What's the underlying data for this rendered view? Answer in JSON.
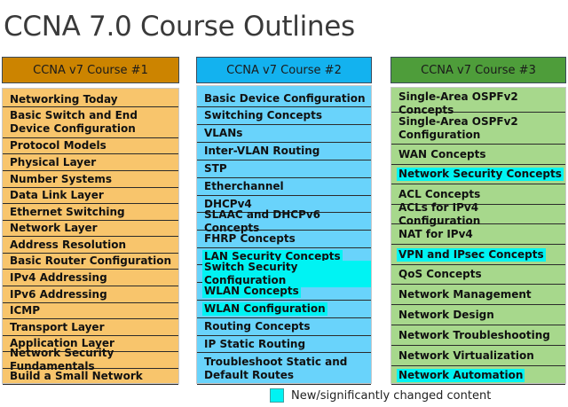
{
  "title": "CCNA 7.0 Course Outlines",
  "colors": {
    "course1_header": "#cc8400",
    "course1_body": "#f8c56c",
    "course2_header": "#13b2ef",
    "course2_body": "#69d3fb",
    "course3_header": "#4e9d3a",
    "course3_body": "#a7d88c",
    "highlight": "#00f3f3"
  },
  "courses": [
    {
      "header": "CCNA v7 Course #1",
      "items": [
        {
          "label": "Networking Today",
          "changed": false
        },
        {
          "label": "Basic Switch and End Device Configuration",
          "changed": false
        },
        {
          "label": "Protocol Models",
          "changed": false
        },
        {
          "label": "Physical Layer",
          "changed": false
        },
        {
          "label": "Number Systems",
          "changed": false
        },
        {
          "label": "Data Link Layer",
          "changed": false
        },
        {
          "label": "Ethernet Switching",
          "changed": false
        },
        {
          "label": "Network Layer",
          "changed": false
        },
        {
          "label": "Address Resolution",
          "changed": false
        },
        {
          "label": "Basic Router Configuration",
          "changed": false
        },
        {
          "label": "IPv4 Addressing",
          "changed": false
        },
        {
          "label": "IPv6 Addressing",
          "changed": false
        },
        {
          "label": "ICMP",
          "changed": false
        },
        {
          "label": "Transport Layer",
          "changed": false
        },
        {
          "label": "Application Layer",
          "changed": false
        },
        {
          "label": "Network Security Fundamentals",
          "changed": false
        },
        {
          "label": "Build a Small Network",
          "changed": false
        }
      ]
    },
    {
      "header": "CCNA v7 Course #2",
      "items": [
        {
          "label": "Basic Device Configuration",
          "changed": false
        },
        {
          "label": "Switching Concepts",
          "changed": false
        },
        {
          "label": "VLANs",
          "changed": false
        },
        {
          "label": "Inter-VLAN Routing",
          "changed": false
        },
        {
          "label": "STP",
          "changed": false
        },
        {
          "label": "Etherchannel",
          "changed": false
        },
        {
          "label": "DHCPv4",
          "changed": false
        },
        {
          "label": "SLAAC and DHCPv6 Concepts",
          "changed": false
        },
        {
          "label": "FHRP Concepts",
          "changed": false
        },
        {
          "label": "LAN Security Concepts",
          "changed": true
        },
        {
          "label": "Switch Security Configuration",
          "changed": true
        },
        {
          "label": "WLAN Concepts",
          "changed": true
        },
        {
          "label": "WLAN Configuration",
          "changed": true
        },
        {
          "label": "Routing Concepts",
          "changed": false
        },
        {
          "label": "IP Static Routing",
          "changed": false
        },
        {
          "label": "Troubleshoot Static and Default Routes",
          "changed": false
        }
      ]
    },
    {
      "header": "CCNA v7 Course #3",
      "items": [
        {
          "label": "Single-Area OSPFv2 Concepts",
          "changed": false
        },
        {
          "label": "Single-Area OSPFv2 Configuration",
          "changed": false
        },
        {
          "label": "WAN Concepts",
          "changed": false
        },
        {
          "label": "Network Security Concepts",
          "changed": true
        },
        {
          "label": "ACL Concepts",
          "changed": false
        },
        {
          "label": "ACLs for IPv4 Configuration",
          "changed": false
        },
        {
          "label": "NAT for IPv4",
          "changed": false
        },
        {
          "label": "VPN and IPsec Concepts",
          "changed": true
        },
        {
          "label": "QoS Concepts",
          "changed": false
        },
        {
          "label": "Network Management",
          "changed": false
        },
        {
          "label": "Network Design",
          "changed": false
        },
        {
          "label": "Network Troubleshooting",
          "changed": false
        },
        {
          "label": "Network Virtualization",
          "changed": false
        },
        {
          "label": "Network Automation",
          "changed": true
        }
      ]
    }
  ],
  "legend": {
    "label": "New/significantly changed content"
  }
}
